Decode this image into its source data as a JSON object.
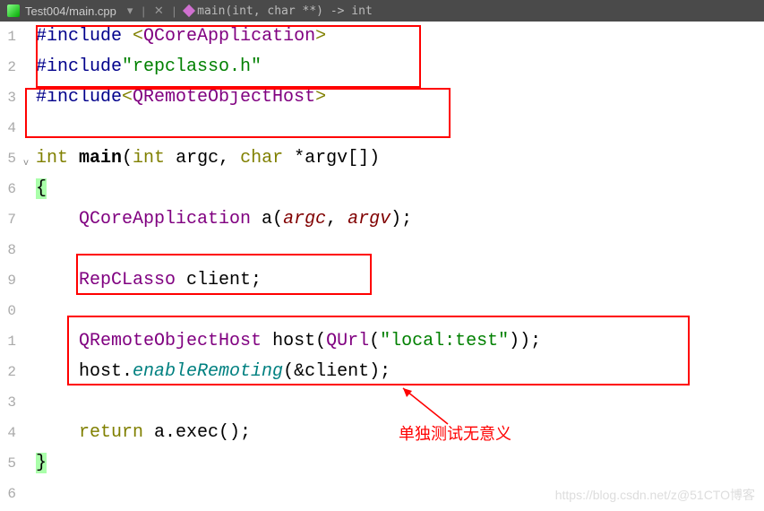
{
  "tab": {
    "filename": "Test004/main.cpp",
    "breadcrumb": "main(int, char **) -> int"
  },
  "gutter": [
    "1",
    "2",
    "3",
    "4",
    "5",
    "6",
    "7",
    "8",
    "9",
    "0",
    "1",
    "2",
    "3",
    "4",
    "5",
    "6"
  ],
  "code": {
    "l1_include": "#include ",
    "l1_lt": "<",
    "l1_class": "QCoreApplication",
    "l1_gt": ">",
    "l2_include": "#include",
    "l2_str": "\"repclasso.h\"",
    "l3_include": "#include",
    "l3_lt": "<",
    "l3_class": "QRemoteObjectHost",
    "l3_gt": ">",
    "l5_int": "int ",
    "l5_main": "main",
    "l5_paren_open": "(",
    "l5_int2": "int",
    "l5_argc": " argc",
    "l5_comma": ", ",
    "l5_char": "char",
    "l5_argv": " *argv",
    "l5_brackets": "[])",
    "l6_brace": "{",
    "l7_indent": "    ",
    "l7_class": "QCoreApplication",
    "l7_a": " a(",
    "l7_argc": "argc",
    "l7_comma": ", ",
    "l7_argv": "argv",
    "l7_close": ");",
    "l9_indent": "    ",
    "l9_class": "RepCLasso",
    "l9_var": " client;",
    "l11_indent": "    ",
    "l11_class": "QRemoteObjectHost",
    "l11_host": " host(",
    "l11_qurl": "QUrl",
    "l11_paren": "(",
    "l11_str": "\"local:test\"",
    "l11_close": "));",
    "l12_indent": "    host.",
    "l12_method": "enableRemoting",
    "l12_args": "(&client);",
    "l14_indent": "    ",
    "l14_return": "return",
    "l14_rest": " a.exec();",
    "l15_brace": "}"
  },
  "annotation": "单独测试无意义",
  "watermark": "https://blog.csdn.net/z@51CTO博客"
}
